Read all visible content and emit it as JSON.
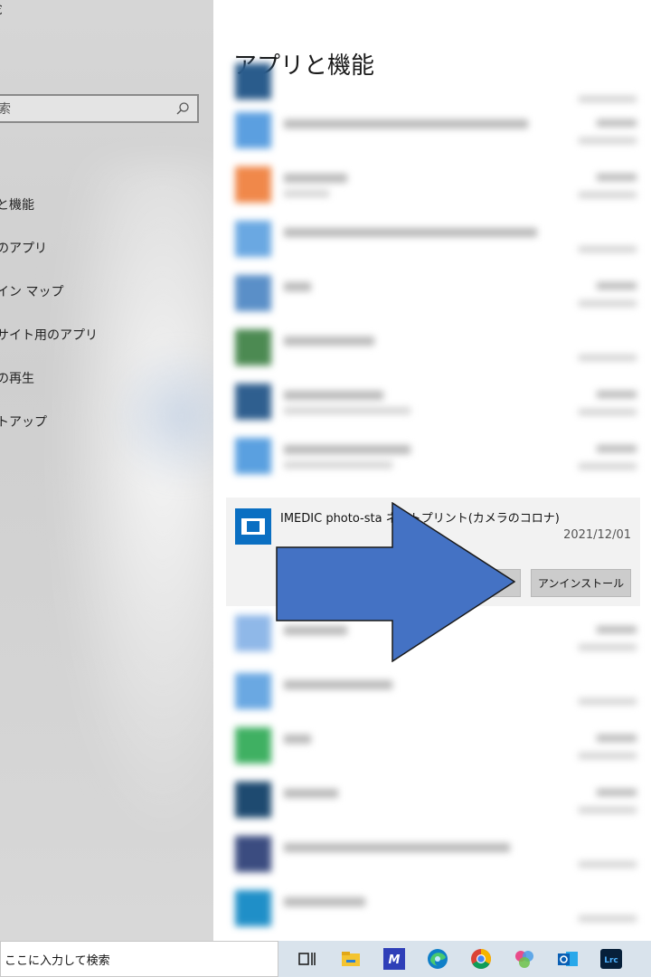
{
  "left": {
    "top_char": "€",
    "search_placeholder": "索",
    "nav_items": [
      "と機能",
      "のアプリ",
      "イン マップ",
      "サイト用のアプリ",
      "の再生",
      "トアップ"
    ]
  },
  "main": {
    "title": "アプリと機能",
    "selected_app": {
      "name": "IMEDIC photo-sta ネットプリント(カメラのコロナ)",
      "date": "2021/12/01",
      "move_label": "",
      "uninstall_label": "アンインストール"
    }
  },
  "taskbar": {
    "search_placeholder": "ここに入力して検索",
    "icons": [
      "task-view-icon",
      "file-explorer-icon",
      "app-ma-icon",
      "edge-icon",
      "chrome-icon",
      "photos-icon",
      "outlook-icon",
      "lightroom-icon"
    ],
    "lightroom_label": "Lrc",
    "app_ma_label": "M"
  },
  "colors": {
    "accent_blue": "#4472c4",
    "app_icon_blue": "#0a6fc2",
    "card_bg": "#f2f2f2"
  }
}
